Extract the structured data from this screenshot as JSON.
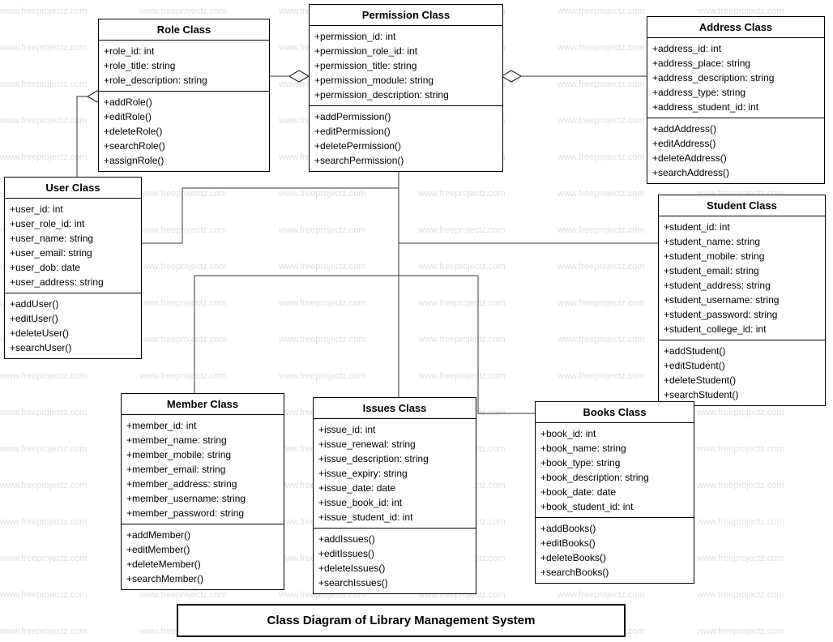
{
  "title": "Class Diagram of Library Management System",
  "watermark": "www.freeprojectz.com",
  "classes": {
    "role": {
      "title": "Role Class",
      "attrs": [
        "+role_id: int",
        "+role_title: string",
        "+role_description: string"
      ],
      "methods": [
        "+addRole()",
        "+editRole()",
        "+deleteRole()",
        "+searchRole()",
        "+assignRole()"
      ]
    },
    "permission": {
      "title": "Permission Class",
      "attrs": [
        "+permission_id: int",
        "+permission_role_id: int",
        "+permission_title: string",
        "+permission_module: string",
        "+permission_description: string"
      ],
      "methods": [
        "+addPermission()",
        "+editPermission()",
        "+deletePermission()",
        "+searchPermission()"
      ]
    },
    "address": {
      "title": "Address Class",
      "attrs": [
        "+address_id: int",
        "+address_place: string",
        "+address_description: string",
        "+address_type: string",
        "+address_student_id: int"
      ],
      "methods": [
        "+addAddress()",
        "+editAddress()",
        "+deleteAddress()",
        "+searchAddress()"
      ]
    },
    "user": {
      "title": "User Class",
      "attrs": [
        "+user_id: int",
        "+user_role_id: int",
        "+user_name: string",
        "+user_email: string",
        "+user_dob: date",
        "+user_address: string"
      ],
      "methods": [
        "+addUser()",
        "+editUser()",
        "+deleteUser()",
        "+searchUser()"
      ]
    },
    "student": {
      "title": "Student Class",
      "attrs": [
        "+student_id: int",
        "+student_name: string",
        "+student_mobile: string",
        "+student_email: string",
        "+student_address: string",
        "+student_username: string",
        "+student_password: string",
        "+student_college_id: int"
      ],
      "methods": [
        "+addStudent()",
        "+editStudent()",
        "+deleteStudent()",
        "+searchStudent()"
      ]
    },
    "member": {
      "title": "Member Class",
      "attrs": [
        "+member_id: int",
        "+member_name: string",
        "+member_mobile: string",
        "+member_email: string",
        "+member_address: string",
        "+member_username: string",
        "+member_password: string"
      ],
      "methods": [
        "+addMember()",
        "+editMember()",
        "+deleteMember()",
        "+searchMember()"
      ]
    },
    "issues": {
      "title": "Issues Class",
      "attrs": [
        "+issue_id: int",
        "+issue_renewal: string",
        "+issue_description: string",
        "+issue_expiry: string",
        "+issue_date: date",
        "+issue_book_id: int",
        "+issue_student_id: int"
      ],
      "methods": [
        "+addIssues()",
        "+editIssues()",
        "+deleteIssues()",
        "+searchIssues()"
      ]
    },
    "books": {
      "title": "Books Class",
      "attrs": [
        "+book_id: int",
        "+book_name: string",
        "+book_type: string",
        "+book_description: string",
        "+book_date: date",
        "+book_student_id: int"
      ],
      "methods": [
        "+addBooks()",
        "+editBooks()",
        "+deleteBooks()",
        "+searchBooks()"
      ]
    }
  }
}
